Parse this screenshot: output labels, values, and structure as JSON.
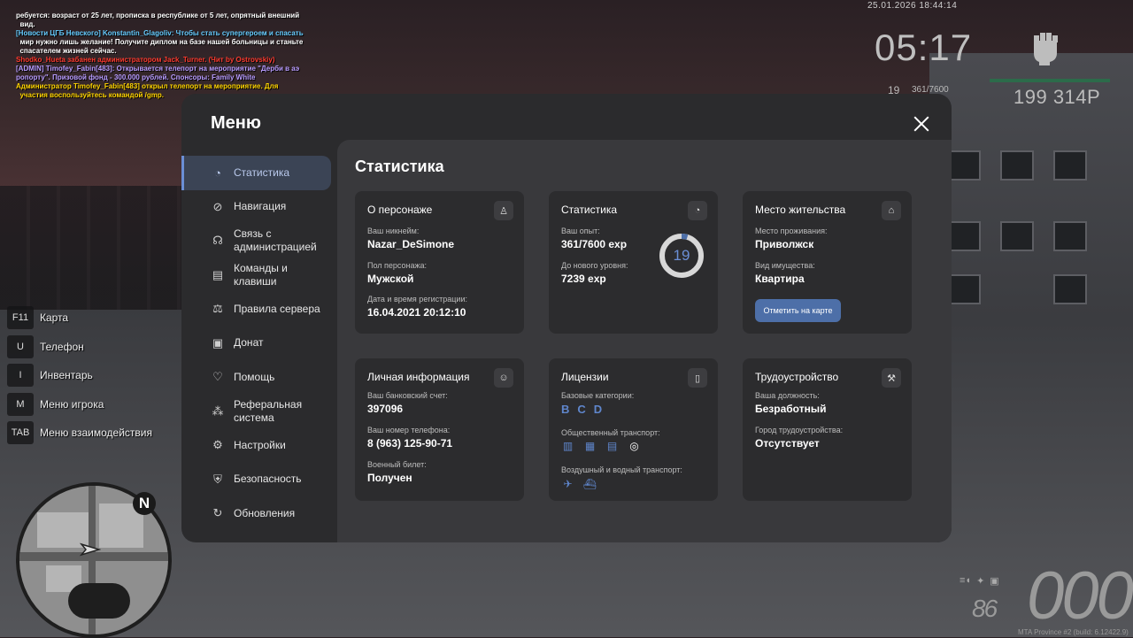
{
  "chat": [
    {
      "text": "ребуется: возраст от 25 лет, прописка в республике от 5 лет, опрятный внешний",
      "color": "#ffffff"
    },
    {
      "text": "  вид.",
      "color": "#ffffff"
    },
    {
      "text": "[Новости ЦГБ Невского] Konstantin_Glagoliv: Чтобы стать супергероем и спасать",
      "color": "#66ccff"
    },
    {
      "text": "  мир нужно лишь желание! Получите диплом на базе нашей больницы и станьте",
      "color": "#ffffff"
    },
    {
      "text": "  спасателем жизней сейчас.",
      "color": "#ffffff"
    },
    {
      "text": "Shodko_Hueta забанен администратором Jack_Turner. (Чит by Ostrovskiy)",
      "color": "#ff3b30"
    },
    {
      "text": "[ADMIN] Timofey_Fabin[483]: Открывается телепорт на мероприятие \"Дерби в аэ",
      "color": "#b89cff"
    },
    {
      "text": "ропорту\". Призовой фонд - 300.000 рублей. Спонсоры: Family White",
      "color": "#b89cff"
    },
    {
      "text": "Администратор Timofey_Fabin[483] открыл телепорт на мероприятие. Для",
      "color": "#ffd400"
    },
    {
      "text": "  участия воспользуйтесь командой /gmp.",
      "color": "#ffd400"
    }
  ],
  "hud": {
    "date": "25.01.2026 18:44:14",
    "time": "05:17",
    "level": "19",
    "exp": "361/7600",
    "money": "199 314Р"
  },
  "hotkeys": [
    {
      "key": "F11",
      "label": "Карта"
    },
    {
      "key": "U",
      "label": "Телефон"
    },
    {
      "key": "I",
      "label": "Инвентарь"
    },
    {
      "key": "M",
      "label": "Меню игрока"
    },
    {
      "key": "TAB",
      "label": "Меню взаимодействия"
    }
  ],
  "minimap": {
    "north": "N"
  },
  "speedo": {
    "speed": "000",
    "fuel": "86"
  },
  "version": "MTA Province #2 (build: 6.12422.9)",
  "menu": {
    "title": "Меню",
    "sidebar": [
      {
        "label": "Статистика",
        "icon": "pie-chart-icon"
      },
      {
        "label": "Навигация",
        "icon": "compass-icon"
      },
      {
        "label": "Связь с администрацией",
        "icon": "headset-icon"
      },
      {
        "label": "Команды и клавиши",
        "icon": "document-icon"
      },
      {
        "label": "Правила сервера",
        "icon": "scales-icon"
      },
      {
        "label": "Донат",
        "icon": "wallet-icon"
      },
      {
        "label": "Помощь",
        "icon": "heart-hand-icon"
      },
      {
        "label": "Реферальная система",
        "icon": "network-icon"
      },
      {
        "label": "Настройки",
        "icon": "gear-icon"
      },
      {
        "label": "Безопасность",
        "icon": "shield-icon"
      },
      {
        "label": "Обновления",
        "icon": "refresh-icon"
      }
    ],
    "content_title": "Статистика",
    "cards": {
      "character": {
        "title": "О персонаже",
        "nick_label": "Ваш никнейм:",
        "nick": "Nazar_DeSimone",
        "gender_label": "Пол персонажа:",
        "gender": "Мужской",
        "reg_label": "Дата и время регистрации:",
        "reg": "16.04.2021 20:12:10"
      },
      "stats": {
        "title": "Статистика",
        "exp_label": "Ваш опыт:",
        "exp": "361/7600 exp",
        "next_label": "До нового уровня:",
        "next": "7239 exp",
        "level": "19",
        "progress": 0.0475
      },
      "residence": {
        "title": "Место жительства",
        "place_label": "Место проживания:",
        "place": "Приволжск",
        "type_label": "Вид имущества:",
        "type": "Квартира",
        "button": "Отметить на карте"
      },
      "personal": {
        "title": "Личная информация",
        "bank_label": "Ваш банковский счет:",
        "bank": "397096",
        "phone_label": "Ваш номер телефона:",
        "phone": "8 (963) 125-90-71",
        "military_label": "Военный билет:",
        "military": "Получен"
      },
      "licenses": {
        "title": "Лицензии",
        "base_label": "Базовые категории:",
        "categories": [
          "B",
          "C",
          "D"
        ],
        "public_label": "Общественный транспорт:",
        "air_label": "Воздушный и водный транспорт:"
      },
      "job": {
        "title": "Трудоустройство",
        "position_label": "Ваша должность:",
        "position": "Безработный",
        "city_label": "Город трудоустройства:",
        "city": "Отсутствует"
      }
    }
  }
}
